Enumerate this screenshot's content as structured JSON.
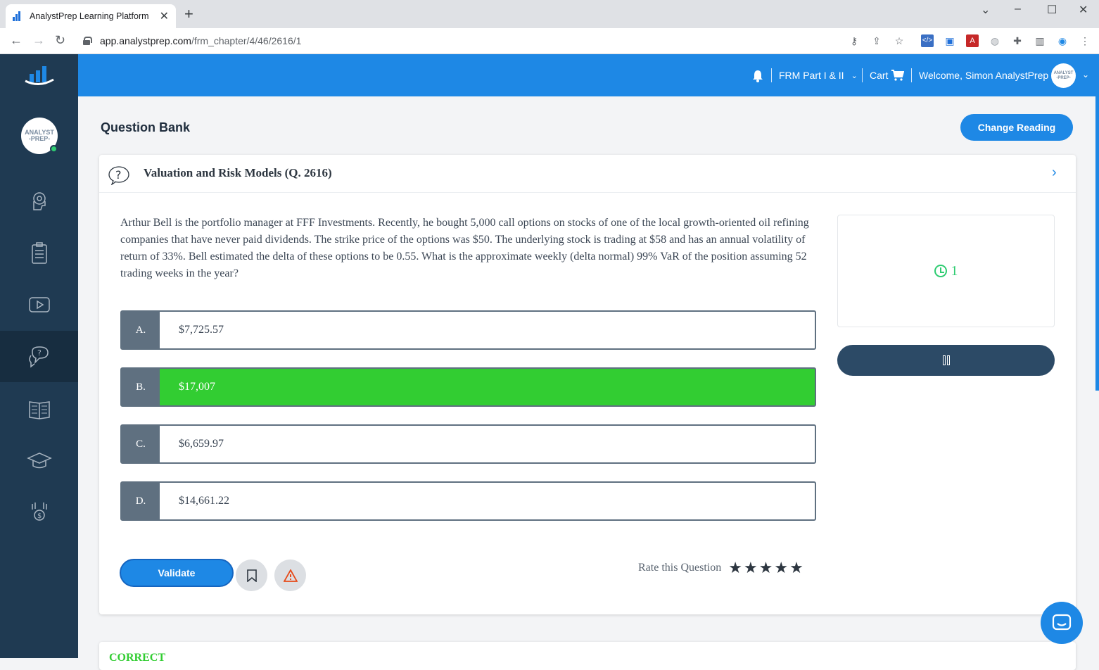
{
  "browser": {
    "tab_title": "AnalystPrep Learning Platform",
    "tab_close": "✕",
    "new_tab": "+",
    "url_host": "app.analystprep.com",
    "url_path": "/frm_chapter/4/46/2616/1"
  },
  "header": {
    "course": "FRM Part I & II",
    "cart": "Cart",
    "welcome": "Welcome, Simon AnalystPrep"
  },
  "sidebar": {
    "avatar_line1": "ANALYST",
    "avatar_line2": "-PREP-",
    "items": [
      "coach-icon",
      "clipboard-icon",
      "video-icon",
      "question-bank-icon",
      "book-icon",
      "graduation-cap-icon",
      "money-hand-icon"
    ],
    "active_index": 3
  },
  "page": {
    "title": "Question Bank",
    "change_reading": "Change Reading"
  },
  "question": {
    "title": "Valuation and Risk Models (Q. 2616)",
    "text": "Arthur Bell is the portfolio manager at FFF Investments. Recently, he bought 5,000 call options on stocks of one of the local growth-oriented oil refining companies that have never paid dividends. The strike price of the options was $50. The underlying stock is trading at $58 and has an annual volatility of return of 33%. Bell estimated the delta of these options to be 0.55. What is the approximate weekly (delta normal) 99% VaR of the position assuming 52 trading weeks in the year?",
    "options": [
      {
        "letter": "A.",
        "value": "$7,725.57"
      },
      {
        "letter": "B.",
        "value": "$17,007"
      },
      {
        "letter": "C.",
        "value": "$6,659.97"
      },
      {
        "letter": "D.",
        "value": "$14,661.22"
      }
    ],
    "correct_index": 1,
    "timer": "1",
    "validate": "Validate",
    "rate_label": "Rate this Question",
    "stars": "★★★★★"
  },
  "result": {
    "label": "CORRECT"
  },
  "colors": {
    "brand_blue": "#1e88e5",
    "sidebar": "#1f3a52",
    "correct_green": "#32cd32"
  }
}
